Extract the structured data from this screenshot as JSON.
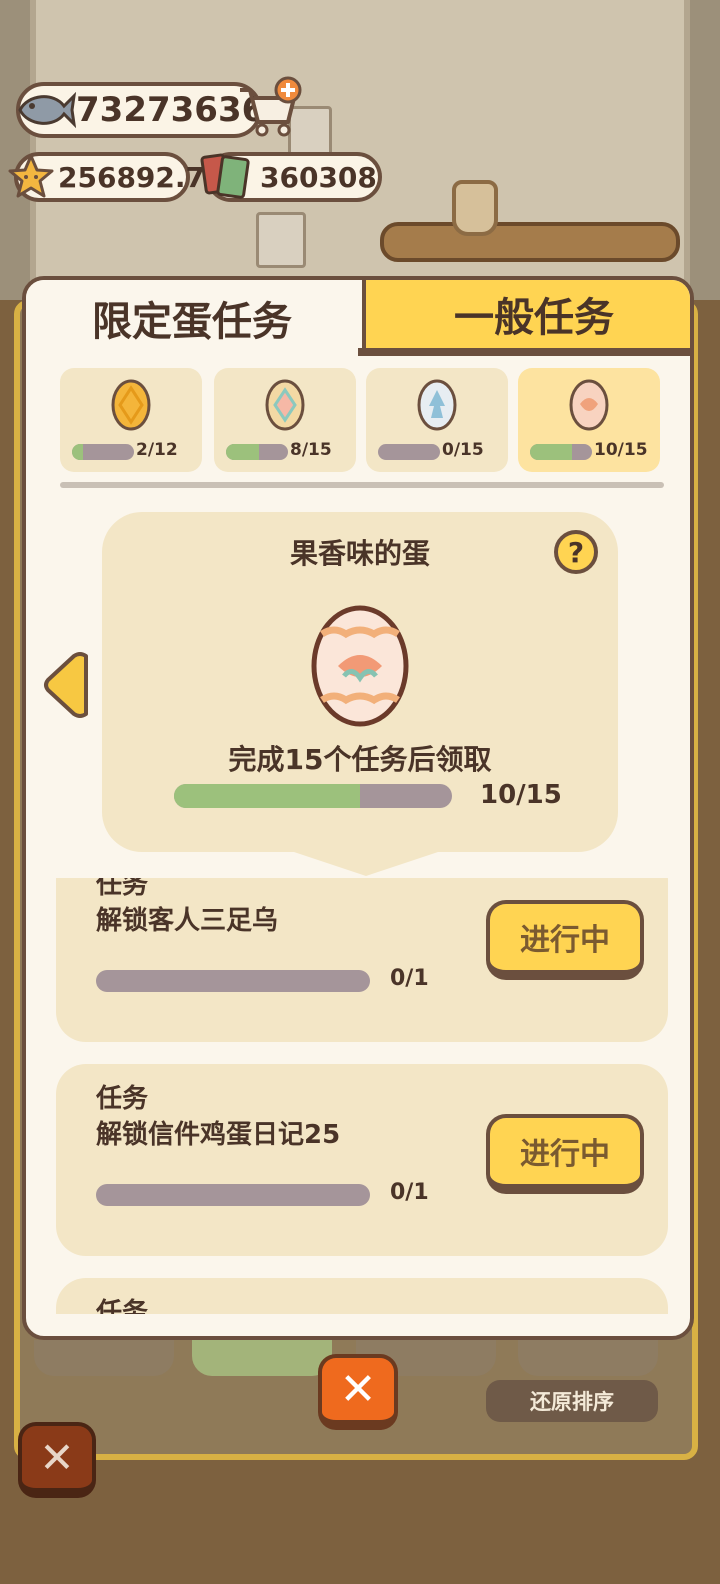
{
  "currency": {
    "fish": "73273636",
    "stars": "256892.7",
    "tickets": "360308"
  },
  "tabs": {
    "limited": "限定蛋任务",
    "general": "一般任务"
  },
  "eggs": [
    {
      "progress": "2/12",
      "fraction": 0.17,
      "colors": {
        "fill": "#f4b53a",
        "pattern": "#e59a1a"
      }
    },
    {
      "progress": "8/15",
      "fraction": 0.53,
      "colors": {
        "fill": "#f3d9a4",
        "pattern": "#8cc9be"
      }
    },
    {
      "progress": "0/15",
      "fraction": 0.0,
      "colors": {
        "fill": "#e7edf2",
        "pattern": "#8fc0d8"
      }
    },
    {
      "progress": "10/15",
      "fraction": 0.67,
      "colors": {
        "fill": "#f8d3c0",
        "pattern": "#f0a27c"
      }
    }
  ],
  "featured": {
    "title": "果香味的蛋",
    "help": "?",
    "caption": "完成15个任务后领取",
    "progress": "10/15",
    "fraction": 0.67
  },
  "tasks": [
    {
      "head": "任务",
      "name": "解锁客人三足乌",
      "count": "0/1",
      "fraction": 0,
      "button": "进行中"
    },
    {
      "head": "任务",
      "name": "解锁信件鸡蛋日记25",
      "count": "0/1",
      "fraction": 0,
      "button": "进行中"
    },
    {
      "head": "任务"
    }
  ],
  "background": {
    "sort_label": "还原排序"
  },
  "close_symbol": "✕",
  "accent_colors": {
    "yellow": "#ffd452",
    "progress_green": "#9cc17c",
    "progress_track": "#a5959a",
    "close_orange": "#ef6a1e"
  }
}
